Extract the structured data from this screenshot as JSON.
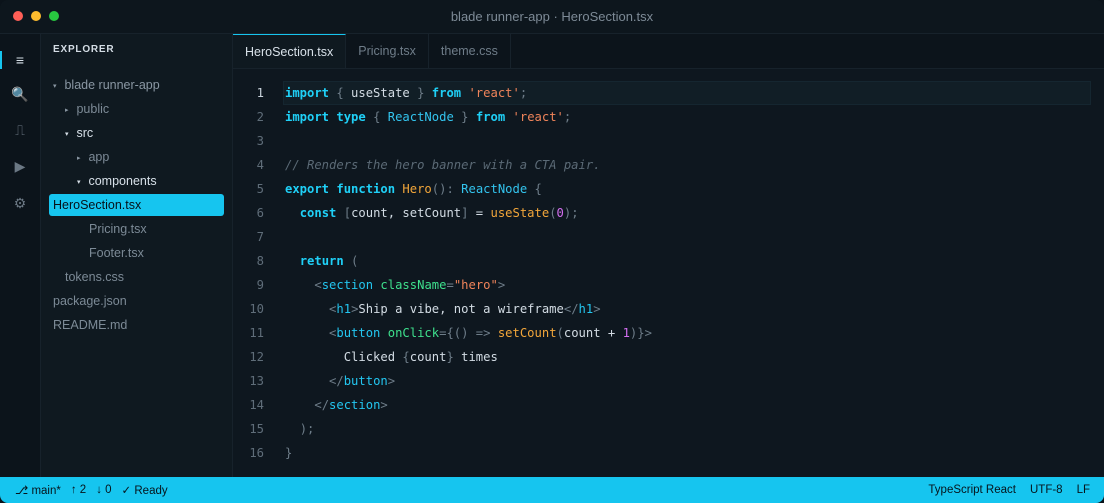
{
  "window": {
    "title": "blade runner-app · HeroSection.tsx"
  },
  "activity_bar": [
    {
      "icon": "files-icon",
      "glyph": "≡"
    },
    {
      "icon": "search-icon",
      "glyph": "🔍"
    },
    {
      "icon": "source-control-icon",
      "glyph": "⎍"
    },
    {
      "icon": "run-icon",
      "glyph": "▶"
    },
    {
      "icon": "settings-icon",
      "glyph": "⚙"
    }
  ],
  "sidebar": {
    "title": "EXPLORER",
    "items": [
      {
        "label": "blade runner-app",
        "twisty": "▾"
      },
      {
        "label": "public",
        "twisty": "▸"
      },
      {
        "label": "src",
        "twisty": "▾"
      },
      {
        "label": "app",
        "twisty": "▸"
      },
      {
        "label": "components",
        "twisty": "▾"
      },
      {
        "label": "HeroSection.tsx",
        "twisty": ""
      },
      {
        "label": "Pricing.tsx",
        "twisty": ""
      },
      {
        "label": "Footer.tsx",
        "twisty": ""
      },
      {
        "label": "tokens.css",
        "twisty": ""
      },
      {
        "label": "package.json",
        "twisty": ""
      },
      {
        "label": "README.md",
        "twisty": ""
      }
    ]
  },
  "tabs": [
    {
      "label": "HeroSection.tsx",
      "active": true
    },
    {
      "label": "Pricing.tsx",
      "active": false
    },
    {
      "label": "theme.css",
      "active": false
    }
  ],
  "editor": {
    "current_line": 1,
    "lines": [
      {
        "n": "1",
        "tokens": [
          [
            "kw",
            "import"
          ],
          [
            "pun",
            " { "
          ],
          [
            "",
            "useState"
          ],
          [
            "pun",
            " } "
          ],
          [
            "kw",
            "from"
          ],
          [
            "",
            " "
          ],
          [
            "str",
            "'react'"
          ],
          [
            "pun",
            ";"
          ]
        ]
      },
      {
        "n": "2",
        "tokens": [
          [
            "kw",
            "import"
          ],
          [
            "",
            " "
          ],
          [
            "kw",
            "type"
          ],
          [
            "pun",
            " { "
          ],
          [
            "ty",
            "ReactNode"
          ],
          [
            "pun",
            " } "
          ],
          [
            "kw",
            "from"
          ],
          [
            "",
            " "
          ],
          [
            "str",
            "'react'"
          ],
          [
            "pun",
            ";"
          ]
        ]
      },
      {
        "n": "3",
        "tokens": []
      },
      {
        "n": "4",
        "tokens": [
          [
            "cmt",
            "// Renders the hero banner with a CTA pair."
          ]
        ]
      },
      {
        "n": "5",
        "tokens": [
          [
            "kw",
            "export"
          ],
          [
            "",
            " "
          ],
          [
            "kw",
            "function"
          ],
          [
            "",
            " "
          ],
          [
            "fn",
            "Hero"
          ],
          [
            "pun",
            "(): "
          ],
          [
            "ty",
            "ReactNode"
          ],
          [
            "pun",
            " {"
          ]
        ]
      },
      {
        "n": "6",
        "tokens": [
          [
            "",
            "  "
          ],
          [
            "kw",
            "const"
          ],
          [
            "",
            " "
          ],
          [
            "pun",
            "["
          ],
          [
            "",
            "count, setCount"
          ],
          [
            "pun",
            "]"
          ],
          [
            "",
            " = "
          ],
          [
            "fn",
            "useState"
          ],
          [
            "pun",
            "("
          ],
          [
            "num",
            "0"
          ],
          [
            "pun",
            ");"
          ]
        ]
      },
      {
        "n": "7",
        "tokens": []
      },
      {
        "n": "8",
        "tokens": [
          [
            "",
            "  "
          ],
          [
            "kw",
            "return"
          ],
          [
            "pun",
            " ("
          ]
        ]
      },
      {
        "n": "9",
        "tokens": [
          [
            "",
            "    "
          ],
          [
            "pun",
            "<"
          ],
          [
            "tag",
            "section"
          ],
          [
            "",
            " "
          ],
          [
            "attr",
            "className"
          ],
          [
            "pun",
            "="
          ],
          [
            "str",
            "\"hero\""
          ],
          [
            "pun",
            ">"
          ]
        ]
      },
      {
        "n": "10",
        "tokens": [
          [
            "",
            "      "
          ],
          [
            "pun",
            "<"
          ],
          [
            "tag",
            "h1"
          ],
          [
            "pun",
            ">"
          ],
          [
            "",
            "Ship a vibe, not a wireframe"
          ],
          [
            "pun",
            "</"
          ],
          [
            "tag",
            "h1"
          ],
          [
            "pun",
            ">"
          ]
        ]
      },
      {
        "n": "11",
        "tokens": [
          [
            "",
            "      "
          ],
          [
            "pun",
            "<"
          ],
          [
            "tag",
            "button"
          ],
          [
            "",
            " "
          ],
          [
            "attr",
            "onClick"
          ],
          [
            "pun",
            "={() => "
          ],
          [
            "fn",
            "setCount"
          ],
          [
            "pun",
            "("
          ],
          [
            "",
            "count + "
          ],
          [
            "num",
            "1"
          ],
          [
            "pun",
            ")}>"
          ]
        ]
      },
      {
        "n": "12",
        "tokens": [
          [
            "",
            "        Clicked "
          ],
          [
            "pun",
            "{"
          ],
          [
            "",
            "count"
          ],
          [
            "pun",
            "}"
          ],
          [
            "",
            " times"
          ]
        ]
      },
      {
        "n": "13",
        "tokens": [
          [
            "",
            "      "
          ],
          [
            "pun",
            "</"
          ],
          [
            "tag",
            "button"
          ],
          [
            "pun",
            ">"
          ]
        ]
      },
      {
        "n": "14",
        "tokens": [
          [
            "",
            "    "
          ],
          [
            "pun",
            "</"
          ],
          [
            "tag",
            "section"
          ],
          [
            "pun",
            ">"
          ]
        ]
      },
      {
        "n": "15",
        "tokens": [
          [
            "",
            "  "
          ],
          [
            "pun",
            ");"
          ]
        ]
      },
      {
        "n": "16",
        "tokens": [
          [
            "pun",
            "}"
          ]
        ]
      }
    ]
  },
  "statusbar": {
    "branch": "⎇ main*",
    "ahead": "↑ 2",
    "behind": "↓ 0",
    "status": "✓ Ready",
    "language": "TypeScript React",
    "encoding": "UTF-8",
    "eol": "LF"
  },
  "colors": {
    "accent": "#16c5ef",
    "background": "#0e171f"
  }
}
